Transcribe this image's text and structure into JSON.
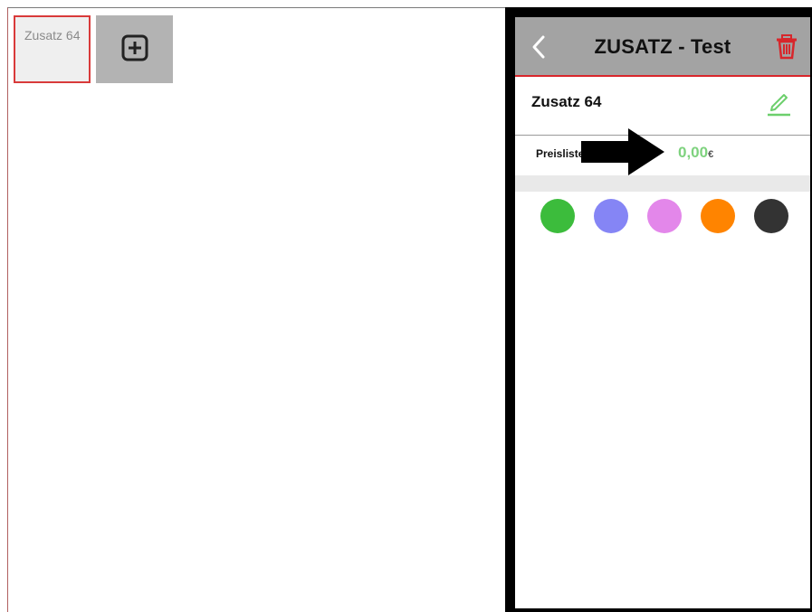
{
  "tiles": {
    "selected_label": "Zusatz 64",
    "add_icon": "plus-square-icon"
  },
  "panel": {
    "title": "ZUSATZ - Test",
    "back_icon": "chevron-left-icon",
    "delete_icon": "trash-icon",
    "name": "Zusatz 64",
    "edit_icon": "pencil-icon",
    "price_label": "Preisliste",
    "price_value": "0,00",
    "currency": "€",
    "annotation_icon": "arrow-right-icon"
  },
  "colors": {
    "header_bg": "#a3a3a3",
    "accent_red": "#d8262b",
    "price_green": "#7ed27e",
    "swatches": [
      "#3cbc3c",
      "#8585f5",
      "#e387ea",
      "#ff8400",
      "#333333"
    ]
  }
}
